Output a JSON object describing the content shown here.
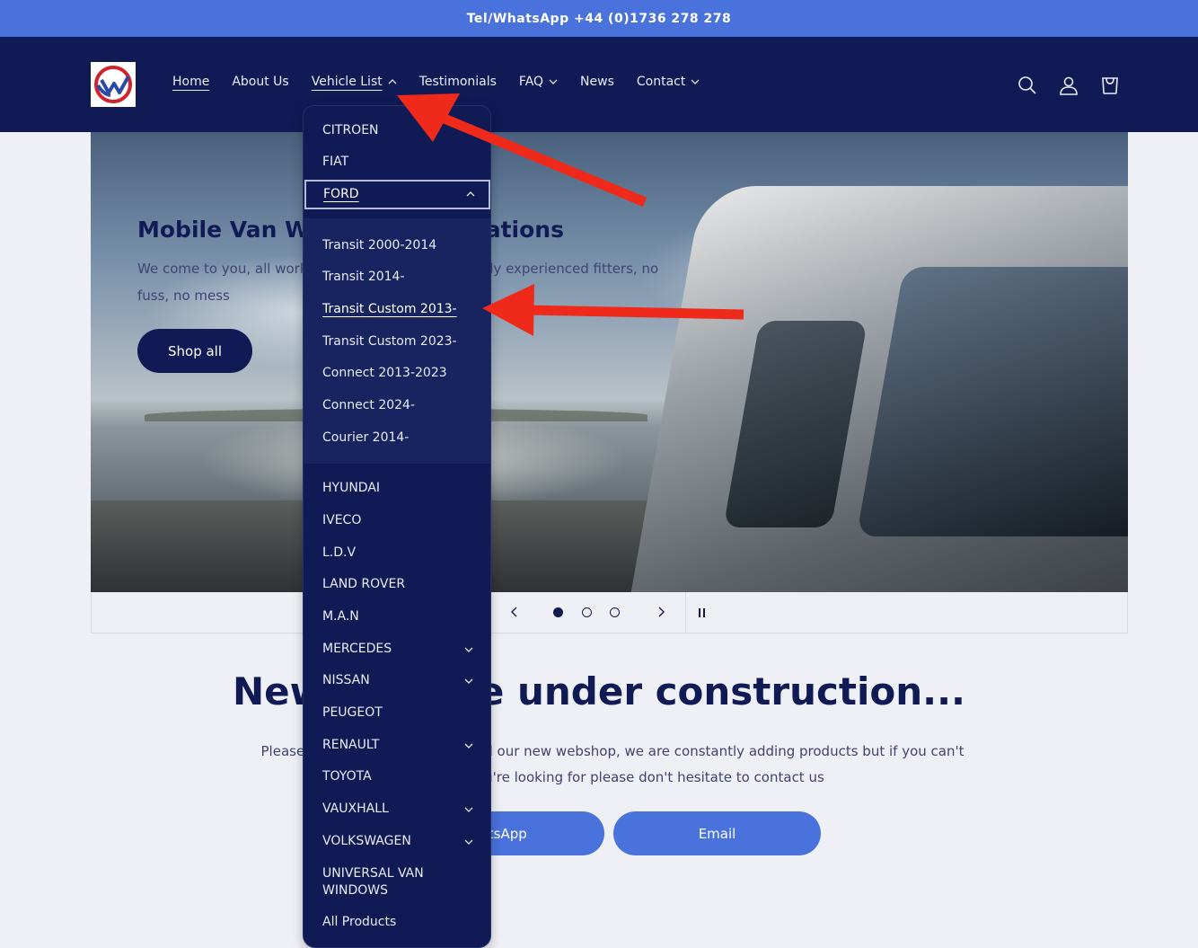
{
  "announcement": "Tel/WhatsApp +44 (0)1736 278 278",
  "nav": {
    "items": [
      "Home",
      "About Us",
      "Vehicle List",
      "Testimonials",
      "FAQ",
      "News",
      "Contact"
    ]
  },
  "hero": {
    "title": "Mobile Van Windows Installations",
    "text": "We come to you, all work carried out on location, fully experienced fitters, no fuss, no mess",
    "button": "Shop all"
  },
  "slider": {
    "slide_count": 3,
    "active_slide": 1
  },
  "construction": {
    "title": "New website under construction...",
    "text": "Please bear with us while we build our new webshop, we are constantly adding products but if you can't find what you're looking for please don't hesitate to contact us",
    "whatsapp_button": "WhatsApp",
    "email_button": "Email"
  },
  "dropdown": {
    "brands_top": [
      "CITROEN",
      "FIAT"
    ],
    "expanded": "FORD",
    "ford_models": [
      "Transit 2000-2014",
      "Transit 2014-",
      "Transit Custom 2013-",
      "Transit Custom 2023-",
      "Connect 2013-2023",
      "Connect 2024-",
      "Courier 2014-"
    ],
    "active_model": "Transit Custom 2013-",
    "brands_bottom": [
      "HYUNDAI",
      "IVECO",
      "L.D.V",
      "LAND ROVER",
      "M.A.N",
      "MERCEDES",
      "NISSAN",
      "PEUGEOT",
      "RENAULT",
      "TOYOTA",
      "VAUXHALL",
      "VOLKSWAGEN"
    ],
    "universal_line1": "UNIVERSAL VAN",
    "universal_line2": "WINDOWS",
    "all_products": "All Products"
  },
  "colors": {
    "navy": "#101b55",
    "accent_blue": "#4a72dc",
    "annotation_red": "#f02a1a"
  }
}
